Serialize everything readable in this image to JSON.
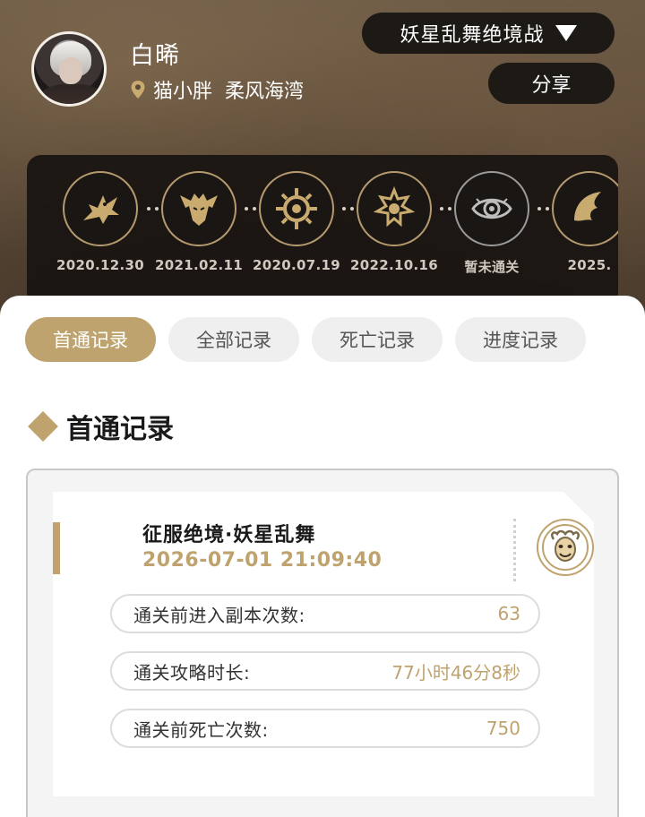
{
  "user": {
    "name": "白晞",
    "location_world": "猫小胖",
    "location_server": "柔风海湾"
  },
  "header": {
    "duty_dropdown": "妖星乱舞绝境战",
    "share_label": "分享"
  },
  "achievements": [
    {
      "icon": "dragon-emblem-icon",
      "date": "2020.12.30"
    },
    {
      "icon": "demon-emblem-icon",
      "date": "2021.02.11"
    },
    {
      "icon": "sun-wheel-emblem-icon",
      "date": "2020.07.19"
    },
    {
      "icon": "spiral-crest-emblem-icon",
      "date": "2022.10.16"
    },
    {
      "icon": "eye-emblem-icon",
      "date": "暂未通关"
    },
    {
      "icon": "wing-emblem-icon",
      "date": "2025."
    }
  ],
  "tabs": [
    {
      "label": "首通记录",
      "active": true
    },
    {
      "label": "全部记录",
      "active": false
    },
    {
      "label": "死亡记录",
      "active": false
    },
    {
      "label": "进度记录",
      "active": false
    }
  ],
  "section": {
    "title": "首通记录"
  },
  "record": {
    "title": "征服绝境·妖星乱舞",
    "time": "2026-07-01 21:09:40",
    "boss_icon": "jester-mask-icon",
    "stats": [
      {
        "label": "通关前进入副本次数:",
        "value": "63"
      },
      {
        "label": "通关攻略时长:",
        "value": "77小时46分8秒"
      },
      {
        "label": "通关前死亡次数:",
        "value": "750"
      }
    ]
  },
  "colors": {
    "accent_gold": "#bfa36e",
    "dark_button": "#1d1915",
    "header_brown": "#5b4a38"
  }
}
